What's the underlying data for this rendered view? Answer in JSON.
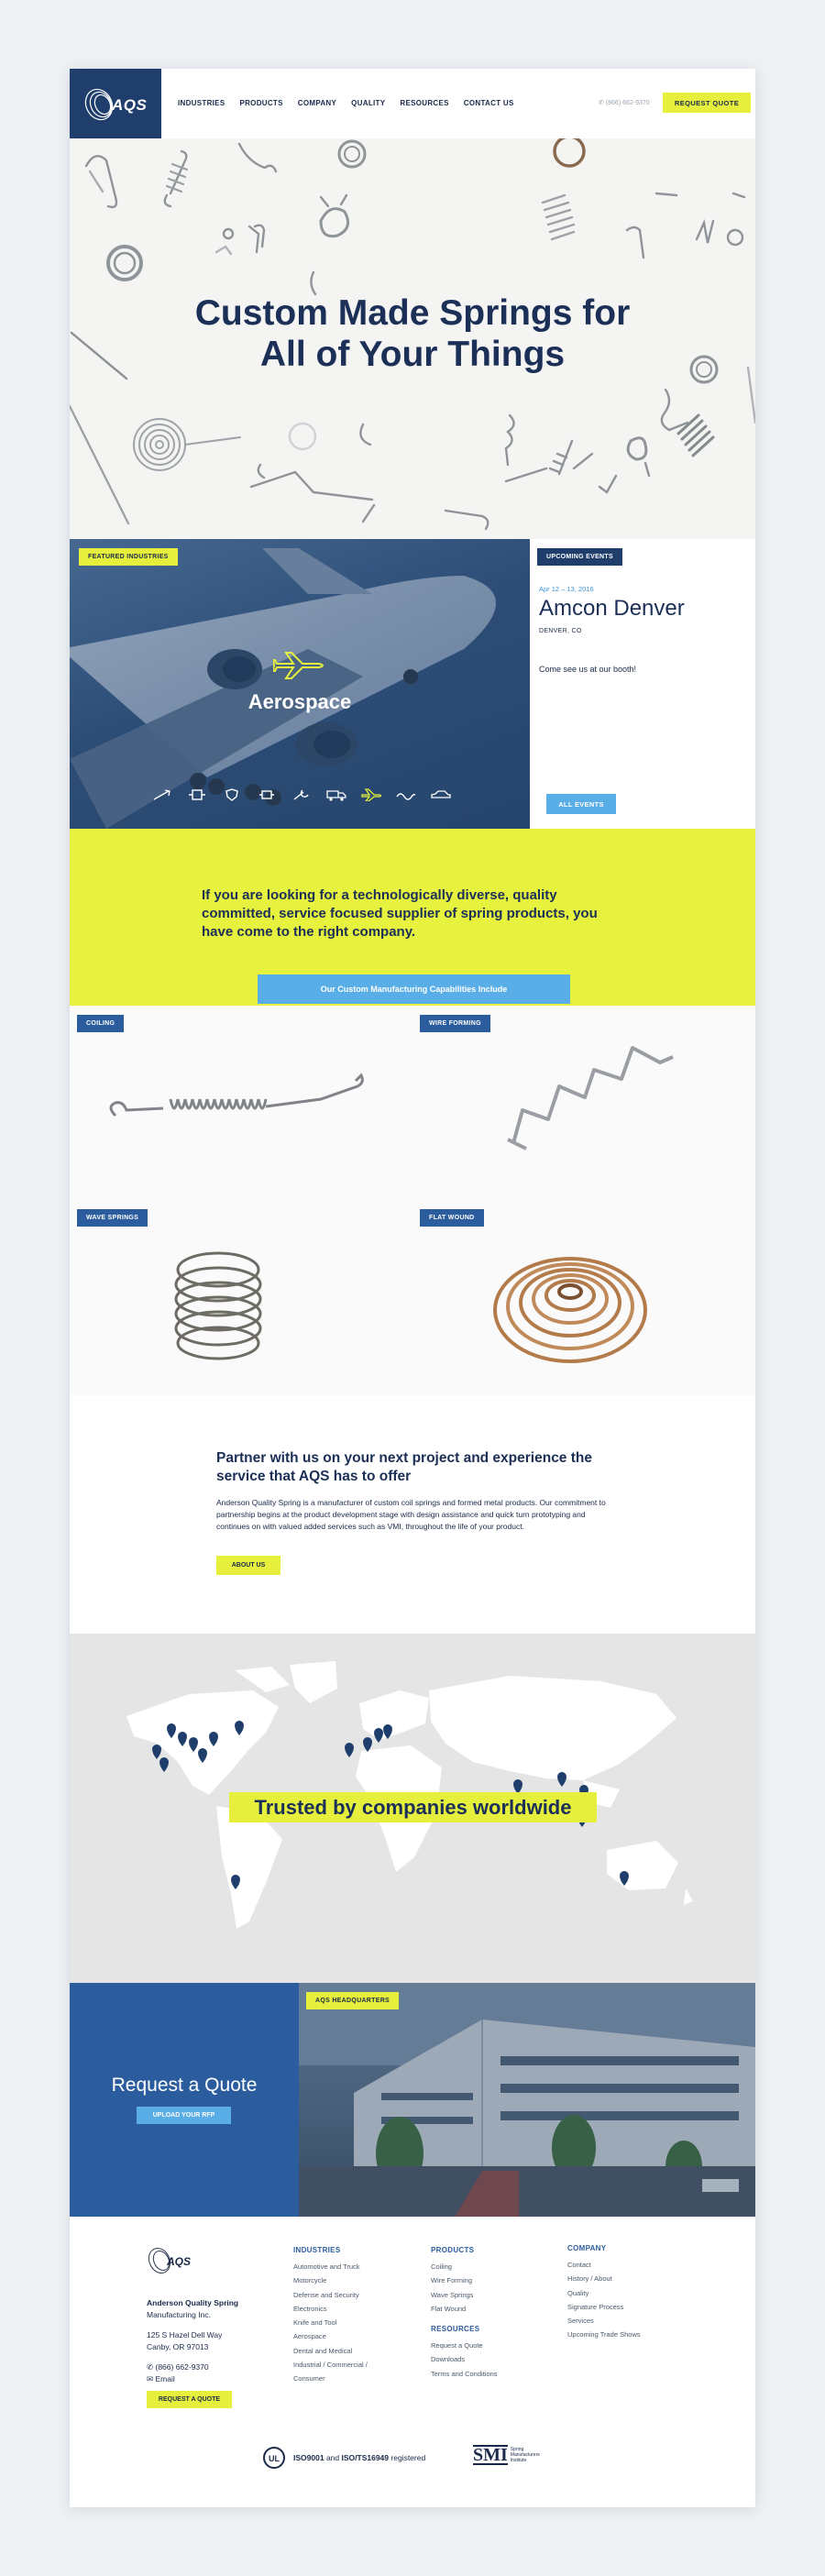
{
  "header": {
    "logo_text": "AQS",
    "nav": [
      "INDUSTRIES",
      "PRODUCTS",
      "COMPANY",
      "QUALITY",
      "RESOURCES",
      "CONTACT US"
    ],
    "phone": "✆ (866) 662-9370",
    "quote_button": "REQUEST QUOTE"
  },
  "hero": {
    "title_line1": "Custom Made Springs for",
    "title_line2": "All of Your Things"
  },
  "featured": {
    "badge": "FEATURED INDUSTRIES",
    "title": "Aerospace",
    "icons": [
      "missile-icon",
      "robot-icon",
      "shield-icon",
      "electronics-icon",
      "wrench-icon",
      "truck-icon",
      "airplane-icon",
      "wave-icon",
      "car-icon"
    ],
    "active_icon": "airplane-icon"
  },
  "events": {
    "badge": "UPCOMING EVENTS",
    "date": "Apr 12 – 13, 2016",
    "title": "Amcon Denver",
    "location": "DENVER, CO",
    "description": "Come see us at our booth!",
    "button": "ALL EVENTS"
  },
  "intro": {
    "text": "If you are looking for a technologically diverse, quality committed, service focused supplier of spring products, you have come to the right company.",
    "button": "Our Custom Manufacturing Capabilities Include"
  },
  "capabilities": [
    {
      "label": "COILING"
    },
    {
      "label": "WIRE FORMING"
    },
    {
      "label": "WAVE SPRINGS"
    },
    {
      "label": "FLAT WOUND"
    }
  ],
  "partner": {
    "heading": "Partner with us on your next project and experience the service that AQS has to offer",
    "body": "Anderson Quality Spring is a manufacturer of custom coil springs and formed metal products. Our commitment to partnership begins at the product development stage with design assistance and quick turn prototyping and continues on with valued added services such as VMI, throughout the life of your product.",
    "button": "ABOUT US"
  },
  "map": {
    "title": "Trusted by companies worldwide"
  },
  "quote": {
    "title": "Request a Quote",
    "button": "UPLOAD YOUR RFP",
    "hq_badge": "AQS HEADQUARTERS"
  },
  "footer": {
    "company_name": "Anderson Quality Spring",
    "company_name2": "Manufacturing Inc.",
    "address1": "125 S Hazel Dell Way",
    "address2": "Canby, OR 97013",
    "phone": "(866) 662-9370",
    "email": "Email",
    "button": "REQUEST A QUOTE",
    "industries_title": "INDUSTRIES",
    "industries": [
      "Automotive and Truck",
      "Motorcycle",
      "Defense and Security",
      "Electronics",
      "Knife and Tool",
      "Aerospace",
      "Dental and Medical",
      "Industrial / Commercial /",
      "Consumer"
    ],
    "products_title": "PRODUCTS",
    "products": [
      "Coiling",
      "Wire Forming",
      "Wave Springs",
      "Flat Wound"
    ],
    "resources_title": "RESOURCES",
    "resources": [
      "Request a Quote",
      "Downloads",
      "Terms and Conditions"
    ],
    "company_title": "COMPANY",
    "company": [
      "Contact",
      "History / About",
      "Quality",
      "Signature Process",
      "Services",
      "Upcoming Trade Shows"
    ],
    "cert_bold": "ISO9001",
    "cert_and": "and",
    "cert_bold2": "ISO/TS16949",
    "cert_rest": "registered",
    "smi_logo": "SMI",
    "smi_text1": "Spring",
    "smi_text2": "Manufacturers",
    "smi_text3": "Institute",
    "ul_mark": "UL"
  },
  "colors": {
    "navy": "#1f3e6c",
    "lime": "#e6f03c",
    "sky": "#5aaee8",
    "blue": "#2b5d9e"
  }
}
